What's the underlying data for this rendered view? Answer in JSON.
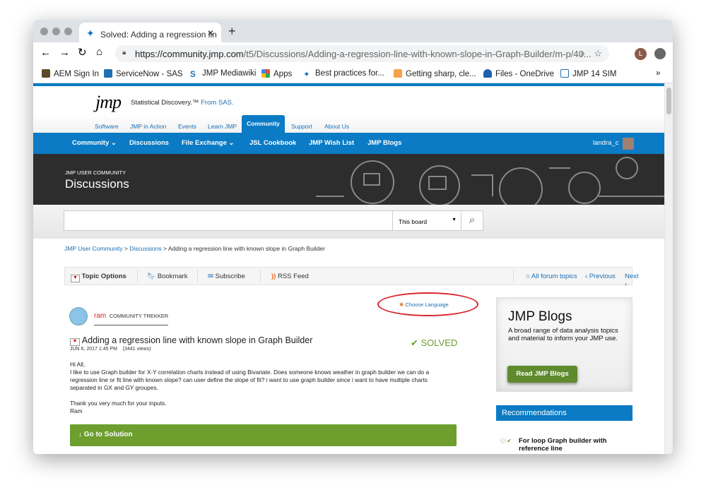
{
  "browser": {
    "tab_title": "Solved: Adding a regression lin",
    "url_host": "https://community.jmp.com",
    "url_path": "/t5/Discussions/Adding-a-regression-line-with-known-slope-in-Graph-Builder/m-p/40...",
    "profile_initial": "L",
    "bookmarks": [
      {
        "label": "AEM Sign In",
        "color": "#5a4a2a"
      },
      {
        "label": "ServiceNow - SAS",
        "color": "#1f6fb2"
      },
      {
        "label": "JMP Mediawiki",
        "color": "#1a6fb5"
      },
      {
        "label": "Apps",
        "color": "#e84a3c"
      },
      {
        "label": "Best practices for...",
        "color": "#1a6fb5"
      },
      {
        "label": "Getting sharp, cle...",
        "color": "#f7a14b"
      },
      {
        "label": "Files - OneDrive",
        "color": "#1f5fb0"
      },
      {
        "label": "JMP 14 SIM",
        "color": "#1a6fb5"
      }
    ],
    "more": "»"
  },
  "header": {
    "logo": "jmp",
    "tagline": "Statistical Discovery.™",
    "tagline_brand": "From SAS.",
    "top_nav": [
      "Software",
      "JMP in Action",
      "Events",
      "Learn JMP",
      "Community",
      "Support",
      "About Us"
    ],
    "sub_nav": [
      "Community ⌄",
      "Discussions",
      "File Exchange ⌄",
      "JSL Cookbook",
      "JMP Wish List",
      "JMP Blogs"
    ],
    "user": "landra_c"
  },
  "banner": {
    "kicker": "JMP USER COMMUNITY",
    "title": "Discussions"
  },
  "search": {
    "placeholder": "",
    "scope": "This board"
  },
  "breadcrumb": [
    "JMP User Community",
    ">",
    "Discussions",
    ">",
    "Adding a regression line with known slope in Graph Builder"
  ],
  "toolbar": {
    "topic_options": "Topic Options",
    "bookmark": "Bookmark",
    "subscribe": "Subscribe",
    "rss": "RSS Feed",
    "all_topics": "All forum topics",
    "previous": "‹  Previous",
    "next": "Next  ›"
  },
  "post": {
    "choose_language": "Choose Language",
    "author": "ram",
    "rank": "COMMUNITY TREKKER",
    "title": "Adding a regression line with known slope in Graph Builder",
    "date": "JUN 6, 2017 1:45 PM",
    "views": "(3441 views)",
    "status": "✔ SOLVED",
    "body": [
      "Hi All,",
      "I like to use Graph builder for  X-Y correlation charts instead of using Bivariate. Does someone knows weather in graph builder we can do a regression line or fit line with known slope?  can user define the slope of fit? i want to use graph builder since i want to have multiple charts separated in GX and GY groupes.",
      "",
      "Thank you very much for your inputs.",
      "Ram"
    ],
    "solution_button": "Go to Solution"
  },
  "sidebar": {
    "blogs_title": "JMP Blogs",
    "blogs_text": "A broad range of data analysis topics and material to inform your JMP use.",
    "blogs_button": "Read JMP Blogs",
    "recs_title": "Recommendations",
    "recs": [
      "For loop Graph builder with reference line"
    ]
  }
}
